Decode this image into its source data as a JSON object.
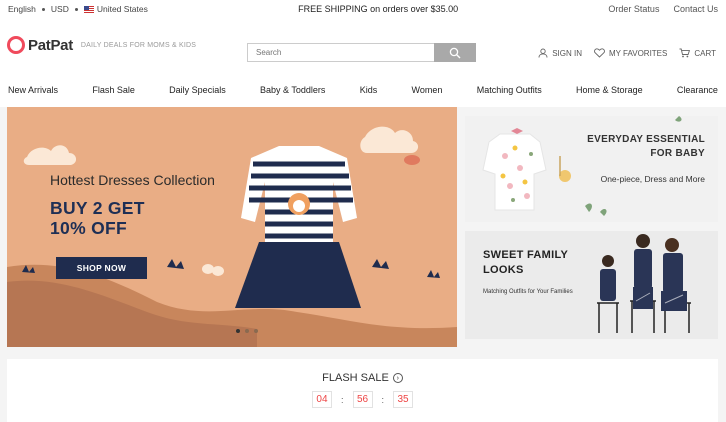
{
  "topbar": {
    "language": "English",
    "currency": "USD",
    "country": "United States",
    "promo": "FREE SHIPPING on orders over $35.00",
    "order_status": "Order Status",
    "contact": "Contact Us"
  },
  "header": {
    "logo": "PatPat",
    "tagline": "DAILY DEALS FOR MOMS & KIDS",
    "search_placeholder": "Search",
    "sign_in": "SIGN IN",
    "favorites": "MY FAVORITES",
    "cart": "CART"
  },
  "nav": [
    "New Arrivals",
    "Flash Sale",
    "Daily Specials",
    "Baby & Toddlers",
    "Kids",
    "Women",
    "Matching Outfits",
    "Home & Storage",
    "Clearance"
  ],
  "hero": {
    "title": "Hottest Dresses Collection",
    "deal_line1": "BUY 2 GET",
    "deal_line2": "10% OFF",
    "cta": "SHOP NOW"
  },
  "side_banner_1": {
    "title_line1": "EVERYDAY ESSENTIAL",
    "title_line2": "FOR BABY",
    "subtitle": "One-piece, Dress and More"
  },
  "side_banner_2": {
    "title_line1": "SWEET FAMILY",
    "title_line2": "LOOKS",
    "subtitle": "Matching Outfits for Your Families"
  },
  "flash_sale": {
    "title": "FLASH SALE",
    "hours": "04",
    "minutes": "56",
    "seconds": "35"
  },
  "colors": {
    "brand": "#f04a5c",
    "hero_bg": "#e9ad85",
    "navy": "#1f2c4e",
    "timer": "#e44444"
  }
}
